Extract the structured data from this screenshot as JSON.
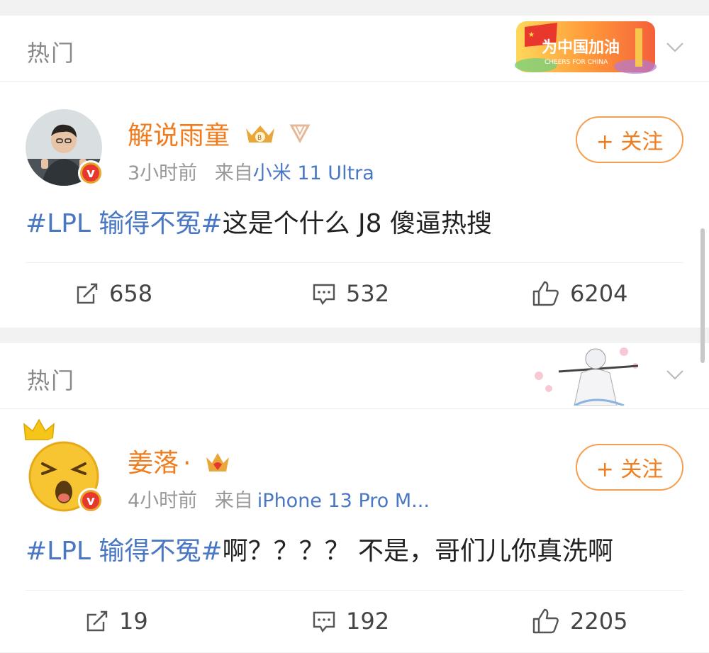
{
  "feed": {
    "cards": [
      {
        "section_label": "热门",
        "banner_text": "为中国加油",
        "banner_subtext": "CHEERS FOR CHINA",
        "post": {
          "username": "解说雨童",
          "time": "3小时前",
          "source_prefix": "来自",
          "source": "小米 11 Ultra",
          "follow_label": "+ 关注",
          "hashtag": "#LPL 输得不冤#",
          "text": "这是个什么 J8 傻逼热搜",
          "reposts": "658",
          "comments": "532",
          "likes": "6204"
        }
      },
      {
        "section_label": "热门",
        "post": {
          "username": "姜落",
          "username_suffix": "·",
          "time": "4小时前",
          "source_prefix": "来自",
          "source": "iPhone 13 Pro M...",
          "follow_label": "+ 关注",
          "hashtag": "#LPL 输得不冤#",
          "text": "啊？？？？ 不是，哥们儿你真洗啊",
          "reposts": "19",
          "comments": "192",
          "likes": "2205"
        }
      }
    ]
  },
  "colors": {
    "username": "#f07c1e",
    "link": "#4a77c3",
    "follow_border": "#f5a050",
    "muted": "#999999"
  },
  "icons": [
    "chevron-down-icon",
    "repost-icon",
    "comment-icon",
    "like-icon",
    "verified-badge-icon",
    "crown-badge-icon"
  ]
}
